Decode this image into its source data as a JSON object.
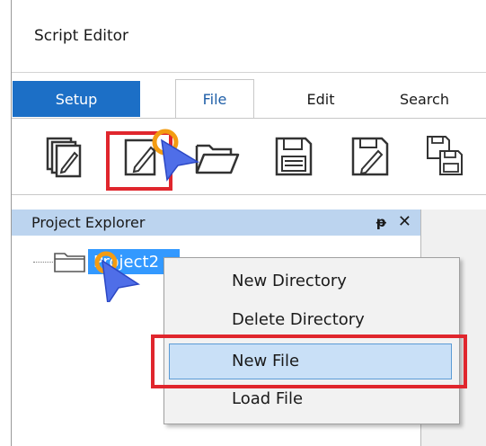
{
  "window": {
    "title": "Script Editor"
  },
  "ribbon": {
    "tabs": [
      {
        "label": "Setup",
        "active_style": "primary"
      },
      {
        "label": "File",
        "selected": true
      },
      {
        "label": "Edit"
      },
      {
        "label": "Search"
      }
    ]
  },
  "toolbar": {
    "buttons": [
      {
        "icon": "new-project-icon"
      },
      {
        "icon": "new-file-icon",
        "highlighted": true
      },
      {
        "icon": "open-folder-icon"
      },
      {
        "icon": "save-icon"
      },
      {
        "icon": "save-as-icon"
      },
      {
        "icon": "save-all-icon"
      }
    ]
  },
  "explorer": {
    "title": "Project Explorer",
    "pin_glyph": "ᵽ",
    "close_glyph": "✕",
    "tree": [
      {
        "label": "Project2",
        "selected": true
      }
    ]
  },
  "context_menu": {
    "items": [
      {
        "label": "New Directory"
      },
      {
        "label": "Delete Directory"
      },
      {
        "label": "New File",
        "hovered": true
      },
      {
        "label": "Load File"
      }
    ]
  },
  "colors": {
    "accent": "#1c6fc6",
    "highlight": "#e0262d",
    "selection": "#3399ff",
    "header": "#bcd4ef"
  }
}
